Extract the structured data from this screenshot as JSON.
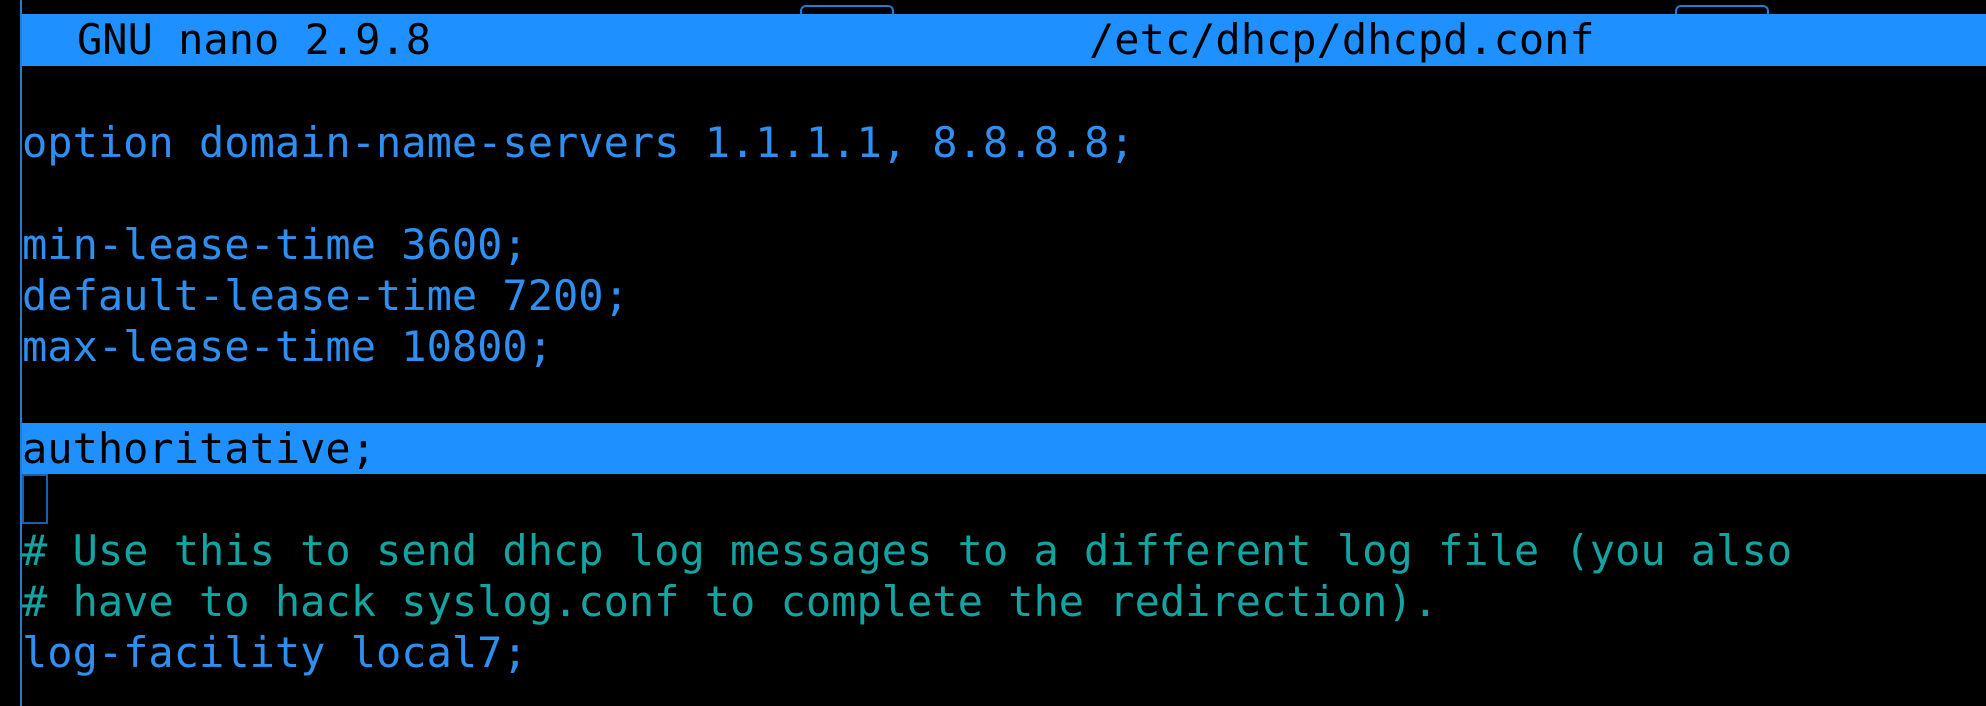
{
  "colors": {
    "titlebar_bg": "#1e90ff",
    "text_blue": "#2e8ff0",
    "comment_teal": "#13a3a0",
    "background": "#000000"
  },
  "titlebar": {
    "app_version": "GNU nano 2.9.8",
    "filename": "/etc/dhcp/dhcpd.conf"
  },
  "editor": {
    "lines": [
      "",
      "option domain-name-servers 1.1.1.1, 8.8.8.8;",
      "",
      "min-lease-time 3600;",
      "default-lease-time 7200;",
      "max-lease-time 10800;",
      "",
      "authoritative;",
      "",
      "# Use this to send dhcp log messages to a different log file (you also",
      "# have to hack syslog.conf to complete the redirection).",
      "log-facility local7;"
    ]
  }
}
